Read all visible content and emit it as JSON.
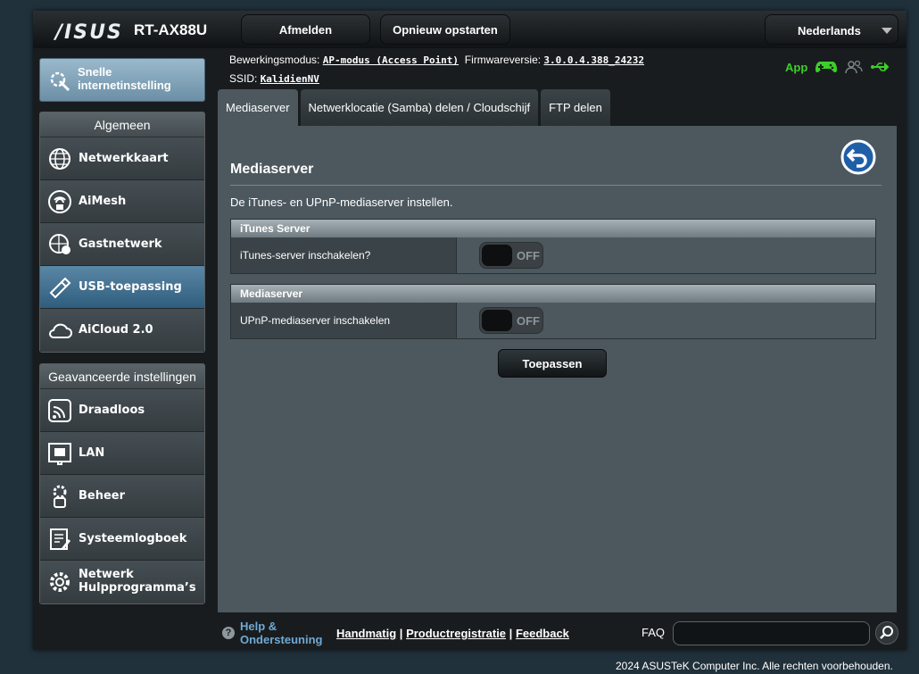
{
  "header": {
    "brand": "/ISUS",
    "model": "RT-AX88U",
    "logout_label": "Afmelden",
    "reboot_label": "Opnieuw opstarten",
    "language": "Nederlands"
  },
  "info": {
    "mode_label": "Bewerkingsmodus:",
    "mode_value": "AP-modus (Access Point)",
    "firmware_label": "Firmwareversie:",
    "firmware_value": "3.0.0.4.388_24232",
    "ssid_label": "SSID:",
    "ssid_value": "KalidienNV",
    "app_label": "App"
  },
  "sidebar": {
    "quick_label_1": "Snelle",
    "quick_label_2": "internetinstelling",
    "general_title": "Algemeen",
    "general_items": [
      {
        "label": "Netwerkkaart"
      },
      {
        "label": "AiMesh"
      },
      {
        "label": "Gastnetwerk"
      },
      {
        "label": "USB-toepassing"
      },
      {
        "label": "AiCloud 2.0"
      }
    ],
    "advanced_title": "Geavanceerde instellingen",
    "advanced_items": [
      {
        "label": "Draadloos"
      },
      {
        "label": "LAN"
      },
      {
        "label": "Beheer"
      },
      {
        "label": "Systeemlogboek"
      },
      {
        "label_1": "Netwerk",
        "label_2": "Hulpprogramma’s"
      }
    ]
  },
  "tabs": [
    {
      "label": "Mediaserver"
    },
    {
      "label": "Netwerklocatie (Samba) delen / Cloudschijf"
    },
    {
      "label": "FTP delen"
    }
  ],
  "panel": {
    "title": "Mediaserver",
    "description": "De iTunes- en UPnP-mediaserver instellen.",
    "itunes_section": "iTunes Server",
    "itunes_label": "iTunes-server inschakelen?",
    "itunes_state": "OFF",
    "media_section": "Mediaserver",
    "upnp_label": "UPnP-mediaserver inschakelen",
    "upnp_state": "OFF",
    "apply_label": "Toepassen"
  },
  "footer": {
    "help_1": "Help &",
    "help_2": "Ondersteuning",
    "manual": "Handmatig",
    "registration": "Productregistratie",
    "feedback": "Feedback",
    "sep": "|",
    "faq": "FAQ",
    "copyright": "2024 ASUSTeK Computer Inc. Alle rechten voorbehouden."
  }
}
